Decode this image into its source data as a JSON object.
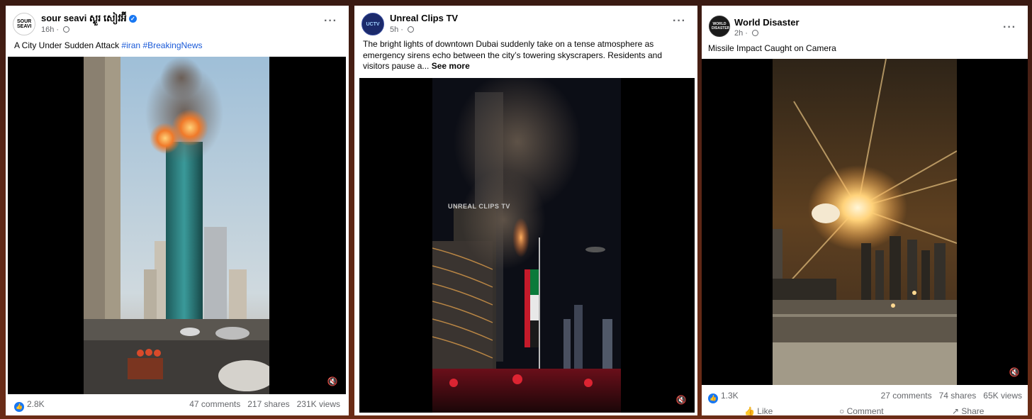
{
  "posts": [
    {
      "author": "sour seavi ស្ងួរ សៀវអ៊ី",
      "avatar_text": "SOUR SEAVI",
      "verified": true,
      "time": "16h",
      "caption_text": "A City Under Sudden Attack ",
      "hashtags": [
        "#iran",
        "#BreakingNews"
      ],
      "likes": "2.8K",
      "comments": "47 comments",
      "shares": "217 shares",
      "views": "231K views"
    },
    {
      "author": "Unreal Clips TV",
      "avatar_text": "UCTV",
      "time": "5h",
      "caption_text": "The bright lights of downtown Dubai suddenly take on a tense atmosphere as emergency sirens echo between the city’s towering skyscrapers. Residents and visitors pause a... ",
      "see_more": "See more",
      "watermark": "UNREAL CLIPS TV"
    },
    {
      "author": "World Disaster",
      "avatar_text": "WORLD DISASTER",
      "time": "2h",
      "caption_text": "Missile Impact Caught on Camera",
      "likes": "1.3K",
      "comments": "27 comments",
      "shares": "74 shares",
      "views": "65K views",
      "actions": [
        "Like",
        "Comment",
        "Share"
      ]
    }
  ],
  "icons": {
    "more": "more-options-icon",
    "globe": "globe-icon",
    "mute": "muted-speaker-icon",
    "like": "like-thumb-icon"
  },
  "colors": {
    "link": "#1a5ad8",
    "facebook_blue": "#1877f2",
    "meta_gray": "#65676b"
  }
}
